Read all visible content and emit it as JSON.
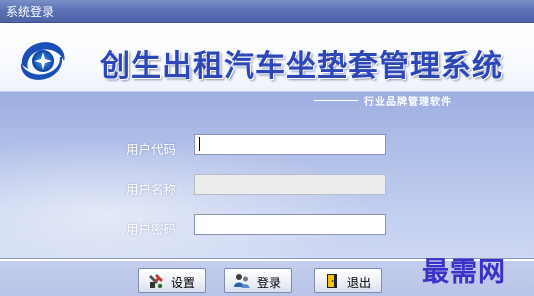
{
  "window": {
    "title": "系统登录"
  },
  "header": {
    "brand": "创生出租汽车坐垫套管理系统",
    "subtitle": "行业品牌管理软件",
    "logo_icon": "swirl-star-logo-icon"
  },
  "form": {
    "user_code": {
      "label": "用户代码",
      "value": ""
    },
    "user_name": {
      "label": "用户名称",
      "value": ""
    },
    "password": {
      "label": "用户密码",
      "value": ""
    }
  },
  "buttons": {
    "settings": {
      "label": "设置",
      "icon": "settings-tools-icon"
    },
    "login": {
      "label": "登录",
      "icon": "login-user-icon"
    },
    "exit": {
      "label": "退出",
      "icon": "exit-door-icon"
    }
  },
  "watermark": "最需网",
  "colors": {
    "titlebar": "#5c72b5",
    "brand_text": "#2d46b8",
    "panel": "#aebde8",
    "watermark": "#3d2fc8"
  }
}
